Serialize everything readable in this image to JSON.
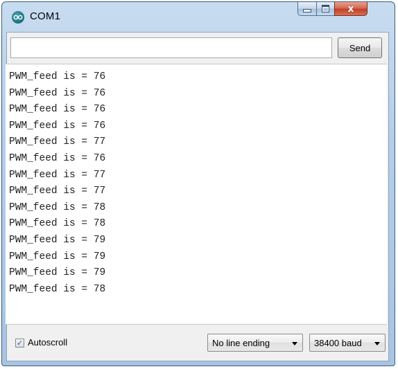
{
  "window": {
    "title": "COM1",
    "close_glyph": "x"
  },
  "input": {
    "value": "",
    "send_label": "Send"
  },
  "output_lines": [
    "PWM_feed is = 76",
    "PWM_feed is = 76",
    "PWM_feed is = 76",
    "PWM_feed is = 76",
    "PWM_feed is = 77",
    "PWM_feed is = 76",
    "PWM_feed is = 77",
    "PWM_feed is = 77",
    "PWM_feed is = 78",
    "PWM_feed is = 78",
    "PWM_feed is = 79",
    "PWM_feed is = 79",
    "PWM_feed is = 79",
    "PWM_feed is = 78"
  ],
  "footer": {
    "autoscroll_label": "Autoscroll",
    "autoscroll_checked": true,
    "line_ending_selected": "No line ending",
    "baud_selected": "38400 baud"
  },
  "icons": {
    "app": "arduino-icon",
    "minimize": "minimize-icon",
    "maximize": "maximize-icon",
    "close": "close-icon",
    "dropdown": "chevron-down-icon",
    "check": "checkmark-icon"
  },
  "colors": {
    "title_bar": "#b4cde8",
    "close_button": "#c24025",
    "output_background": "#ffffff",
    "client_background": "#f0f0f0"
  }
}
